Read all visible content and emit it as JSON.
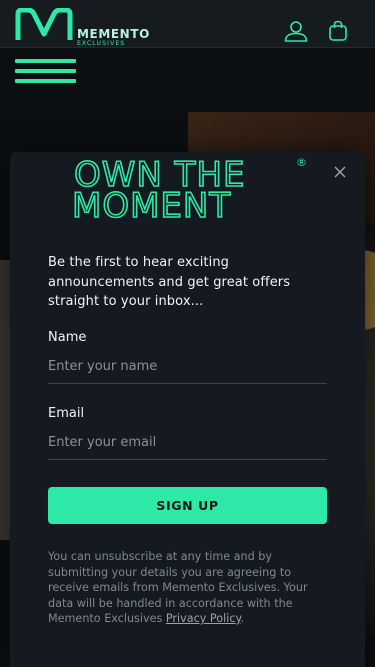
{
  "header": {
    "brand_name": "MEMENTO",
    "brand_sub": "EXCLUSIVES",
    "account_icon": "user-icon",
    "bag_icon": "shopping-bag-icon"
  },
  "menu": {
    "icon": "hamburger-menu-icon"
  },
  "modal": {
    "headline_line1": "OWN THE",
    "headline_line2": "MOMENT",
    "headline_mark": "®",
    "intro": "Be the first to hear exciting announcements and get great offers straight to your inbox...",
    "name_label": "Name",
    "name_placeholder": "Enter your name",
    "email_label": "Email",
    "email_placeholder": "Enter your email",
    "signup_label": "SIGN UP",
    "disclaimer": "You can unsubscribe at any time and by submitting your details you are agreeing to receive emails from Memento Exclusives. Your data will be handled in accordance with the Memento Exclusives ",
    "privacy_link": "Privacy Policy",
    "disclaimer_end": ".",
    "close_icon": "close-icon"
  },
  "colors": {
    "accent": "#2ee8a7",
    "background": "#0c0f12",
    "panel": "#141a20"
  }
}
